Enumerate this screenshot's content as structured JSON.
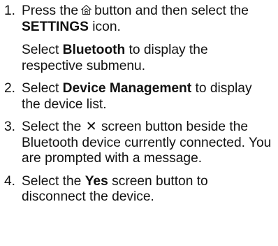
{
  "steps": [
    {
      "number": "1.",
      "paragraphs": [
        {
          "pre": "Press the",
          "icon": "home-icon",
          "mid": "button and then select the",
          "bold": "SETTINGS",
          "post": "icon."
        },
        {
          "pre": "Select",
          "bold": "Bluetooth",
          "post": "to display the respective submenu."
        }
      ]
    },
    {
      "number": "2.",
      "pre": "Select",
      "bold": "Device Management",
      "post": "to display the device list."
    },
    {
      "number": "3.",
      "pre": "Select the",
      "glyph": "✕",
      "glyph_name": "close-x-icon",
      "post": "screen button beside the Bluetooth device currently connected. You are prompted with a message."
    },
    {
      "number": "4.",
      "pre": "Select the",
      "bold": "Yes",
      "post": "screen button to disconnect the device."
    }
  ]
}
